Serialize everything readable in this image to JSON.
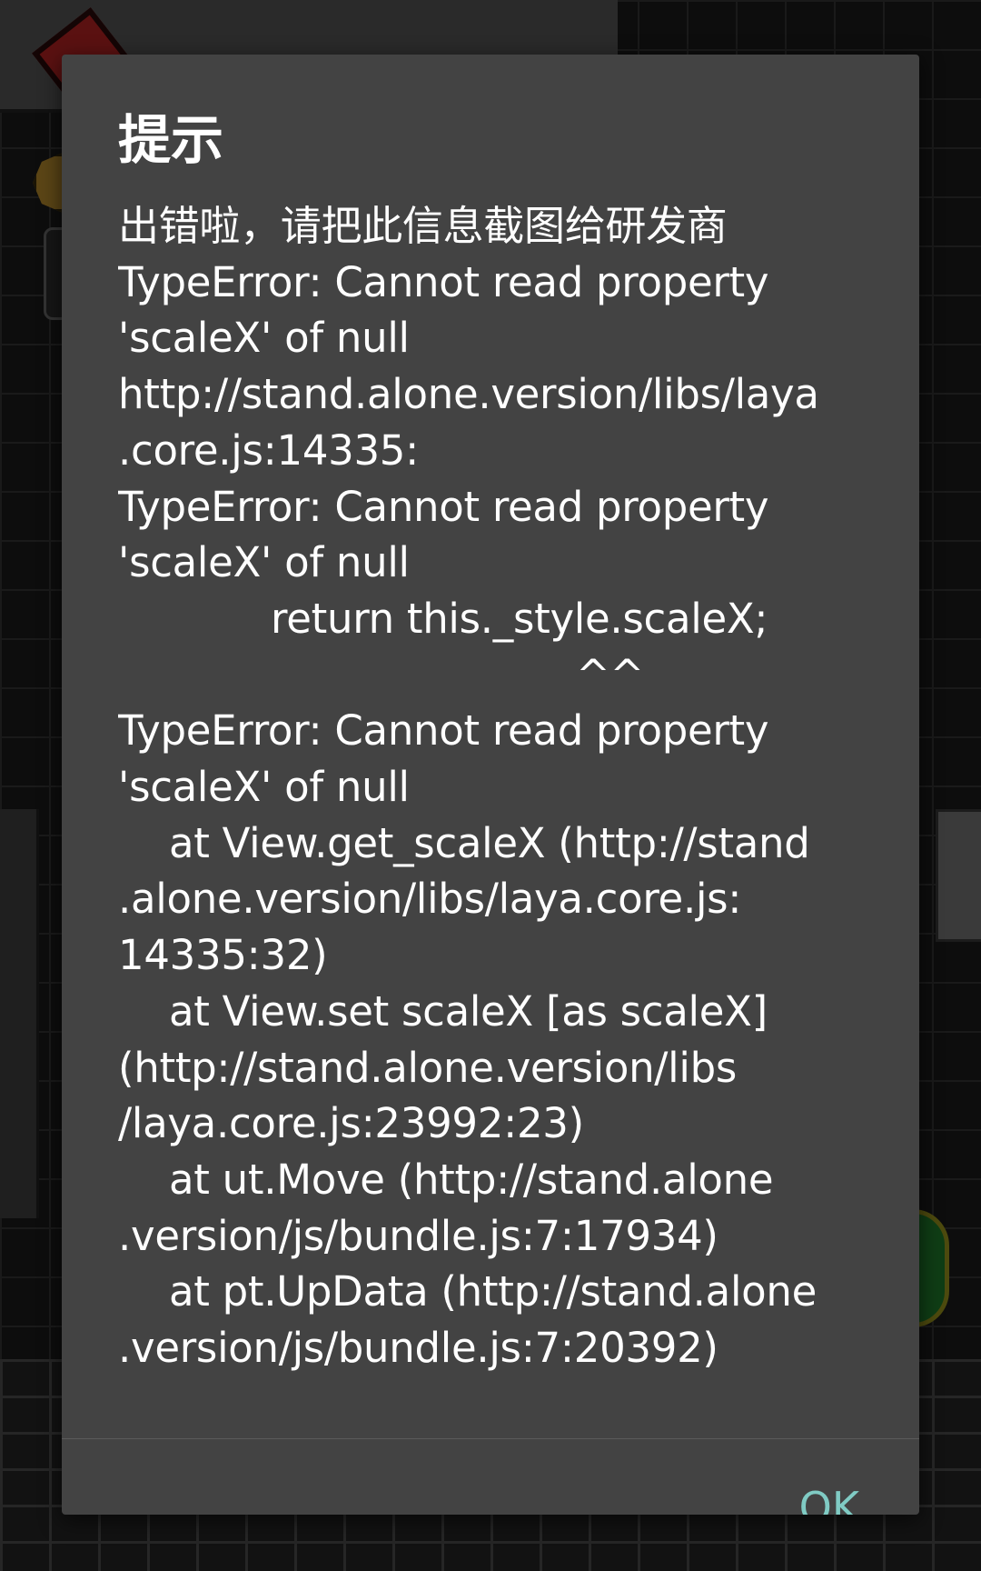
{
  "dialog": {
    "title": "提示",
    "message_lines": [
      "出错啦，请把此信息截图给研发商",
      "TypeError: Cannot read property",
      "'scaleX' of null",
      "http://stand.alone.version/libs/laya",
      ".core.js:14335:",
      "TypeError: Cannot read property",
      "'scaleX' of null",
      "            return this._style.scaleX;",
      "                                    ^^",
      "TypeError: Cannot read property",
      "'scaleX' of null",
      "    at View.get_scaleX (http://stand",
      ".alone.version/libs/laya.core.js:",
      "14335:32)",
      "    at View.set scaleX [as scaleX]",
      "(http://stand.alone.version/libs",
      "/laya.core.js:23992:23)",
      "    at ut.Move (http://stand.alone",
      ".version/js/bundle.js:7:17934)",
      "    at pt.UpData (http://stand.alone",
      ".version/js/bundle.js:7:20392)"
    ],
    "ok_label": "OK",
    "accent_color": "#80cbc4",
    "background_color": "#434343"
  }
}
